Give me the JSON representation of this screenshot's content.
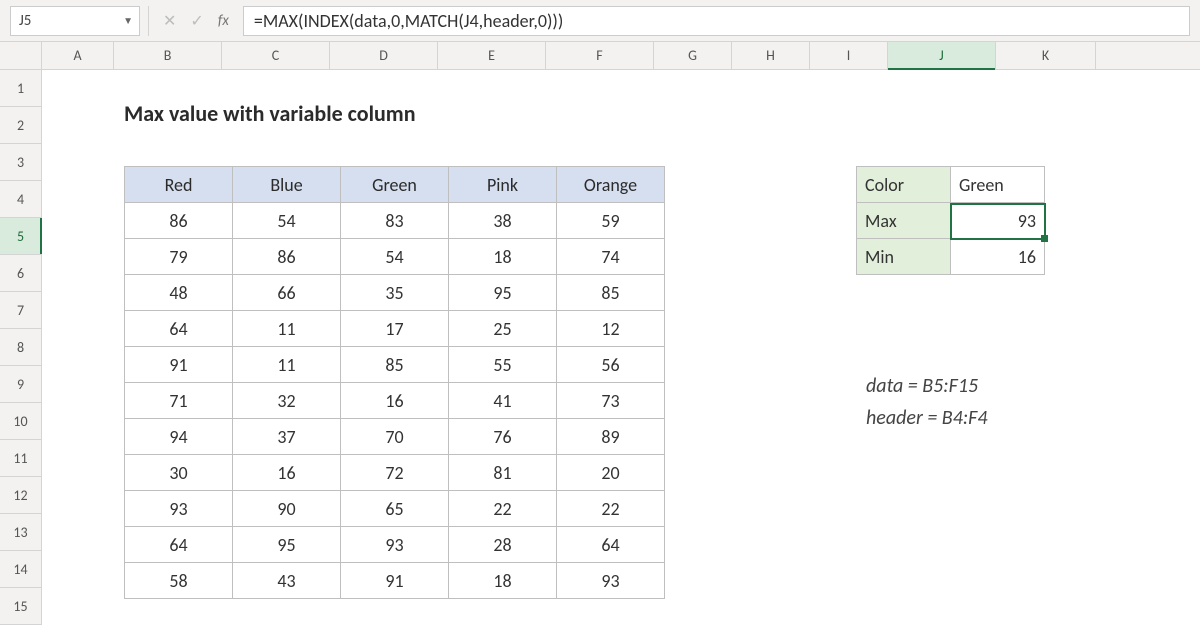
{
  "formula_bar": {
    "cell_ref": "J5",
    "fx_label": "fx",
    "formula": "=MAX(INDEX(data,0,MATCH(J4,header,0)))"
  },
  "columns": [
    "A",
    "B",
    "C",
    "D",
    "E",
    "F",
    "G",
    "H",
    "I",
    "J",
    "K"
  ],
  "active_column": "J",
  "rows": [
    "1",
    "2",
    "3",
    "4",
    "5",
    "6",
    "7",
    "8",
    "9",
    "10",
    "11",
    "12",
    "13",
    "14",
    "15"
  ],
  "active_row": "5",
  "title": "Max value with variable column",
  "chart_data": {
    "type": "table",
    "headers": [
      "Red",
      "Blue",
      "Green",
      "Pink",
      "Orange"
    ],
    "rows": [
      [
        86,
        54,
        83,
        38,
        59
      ],
      [
        79,
        86,
        54,
        18,
        74
      ],
      [
        48,
        66,
        35,
        95,
        85
      ],
      [
        64,
        11,
        17,
        25,
        12
      ],
      [
        91,
        11,
        85,
        55,
        56
      ],
      [
        71,
        32,
        16,
        41,
        73
      ],
      [
        94,
        37,
        70,
        76,
        89
      ],
      [
        30,
        16,
        72,
        81,
        20
      ],
      [
        93,
        90,
        65,
        22,
        22
      ],
      [
        64,
        95,
        93,
        28,
        64
      ],
      [
        58,
        43,
        91,
        18,
        93
      ]
    ]
  },
  "summary": {
    "color_label": "Color",
    "color_value": "Green",
    "max_label": "Max",
    "max_value": "93",
    "min_label": "Min",
    "min_value": "16"
  },
  "notes": {
    "line1": "data = B5:F15",
    "line2": "header = B4:F4"
  }
}
